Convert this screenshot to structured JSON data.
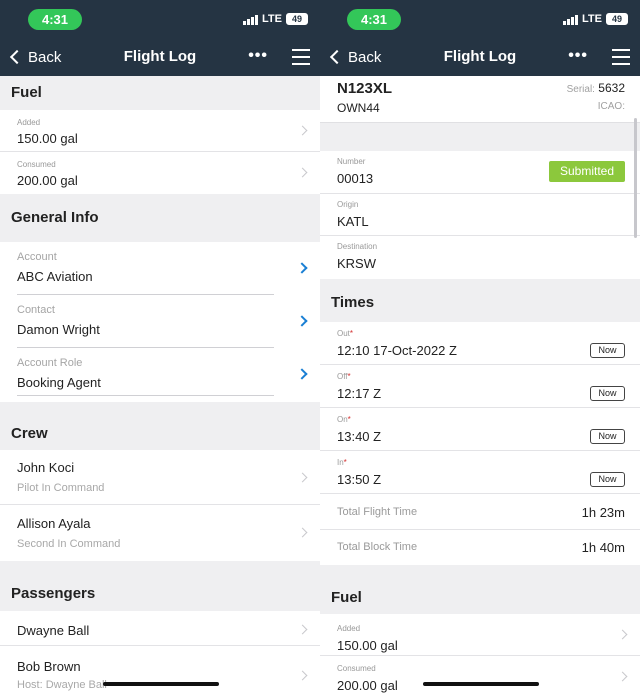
{
  "left": {
    "status": {
      "time": "4:31",
      "network": "LTE",
      "battery": "49"
    },
    "nav": {
      "back_label": "Back",
      "title": "Flight Log",
      "more_label": "•••"
    },
    "fuel": {
      "title": "Fuel",
      "added_label": "Added",
      "added_value": "150.00 gal",
      "consumed_label": "Consumed",
      "consumed_value": "200.00 gal"
    },
    "general": {
      "title": "General Info",
      "account_label": "Account",
      "account_value": "ABC Aviation",
      "contact_label": "Contact",
      "contact_value": "Damon Wright",
      "role_label": "Account Role",
      "role_value": "Booking Agent"
    },
    "crew": {
      "title": "Crew",
      "members": [
        {
          "name": "John Koci",
          "role": "Pilot In Command"
        },
        {
          "name": "Allison Ayala",
          "role": "Second In Command"
        }
      ]
    },
    "passengers": {
      "title": "Passengers",
      "items": [
        {
          "name": "Dwayne Ball",
          "sub": ""
        },
        {
          "name": "Bob Brown",
          "sub": "Host: Dwayne Ball"
        }
      ]
    }
  },
  "right": {
    "status": {
      "time": "4:31",
      "network": "LTE",
      "battery": "49"
    },
    "nav": {
      "back_label": "Back",
      "title": "Flight Log",
      "more_label": "•••"
    },
    "aircraft": {
      "tail": "N123XL",
      "serial_label": "Serial:",
      "serial_value": "5632",
      "owner": "OWN44",
      "icao_label": "ICAO:"
    },
    "flight": {
      "number_label": "Number",
      "number_value": "00013",
      "status_badge": "Submitted",
      "origin_label": "Origin",
      "origin_value": "KATL",
      "destination_label": "Destination",
      "destination_value": "KRSW"
    },
    "times": {
      "title": "Times",
      "now_label": "Now",
      "required_mark": "*",
      "out_label": "Out",
      "out_value": "12:10 17-Oct-2022 Z",
      "off_label": "Off",
      "off_value": "12:17 Z",
      "on_label": "On",
      "on_value": "13:40 Z",
      "in_label": "In",
      "in_value": "13:50 Z",
      "total_flight_label": "Total Flight Time",
      "total_flight_value": "1h 23m",
      "total_block_label": "Total Block Time",
      "total_block_value": "1h 40m"
    },
    "fuel": {
      "title": "Fuel",
      "added_label": "Added",
      "added_value": "150.00 gal",
      "consumed_label": "Consumed",
      "consumed_value": "200.00 gal"
    }
  },
  "colors": {
    "navbar": "#253443",
    "status_pill": "#33c759",
    "submitted_badge": "#8cc83c",
    "link_chevron": "#1a7fd4"
  }
}
